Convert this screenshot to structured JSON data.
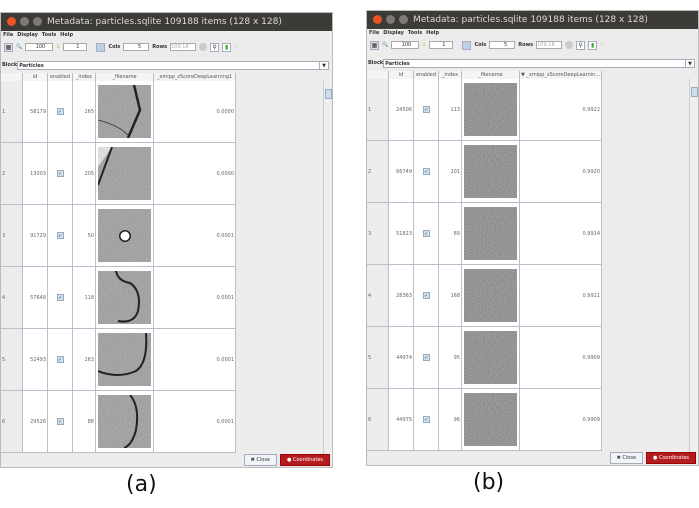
{
  "windows": [
    {
      "title": "Metadata: particles.sqlite 109188 items (128 x 128)",
      "menu": [
        "File",
        "Display",
        "Tools",
        "Help"
      ],
      "toolbar": {
        "zoom": "100",
        "goto": "1",
        "cols_label": "Cols",
        "cols": "5",
        "rows_label": "Rows",
        "rows": "109,18"
      },
      "block_label": "Block",
      "block_value": "Particles",
      "columns": [
        "id",
        "enabled",
        "_index",
        "_filename",
        "_xmipp_zScoreDeepLearning1"
      ],
      "rows": [
        {
          "n": "1",
          "id": "58179",
          "index": "165",
          "score": "0.0000",
          "img": "edge1"
        },
        {
          "n": "2",
          "id": "13003",
          "index": "205",
          "score": "0.0000",
          "img": "edge2"
        },
        {
          "n": "3",
          "id": "91729",
          "index": "50",
          "score": "0.0001",
          "img": "dot"
        },
        {
          "n": "4",
          "id": "57648",
          "index": "118",
          "score": "0.0001",
          "img": "edge3"
        },
        {
          "n": "5",
          "id": "52493",
          "index": "163",
          "score": "0.0001",
          "img": "edge4"
        },
        {
          "n": "6",
          "id": "29526",
          "index": "88",
          "score": "0.0001",
          "img": "edge5"
        }
      ],
      "buttons": {
        "close": "Close",
        "coords": "Coordinates"
      },
      "caption": "(a)"
    },
    {
      "title": "Metadata: particles.sqlite 109188 items (128 x 128)",
      "menu": [
        "File",
        "Display",
        "Tools",
        "Help"
      ],
      "toolbar": {
        "zoom": "100",
        "goto": "1",
        "cols_label": "Cols",
        "cols": "5",
        "rows_label": "Rows",
        "rows": "109,18"
      },
      "block_label": "Block",
      "block_value": "Particles",
      "columns": [
        "id",
        "enabled",
        "_index",
        "_filename",
        "▼ _xmipp_zScoreDeepLearnin..."
      ],
      "rows": [
        {
          "n": "1",
          "id": "24506",
          "index": "113",
          "score": "0.9922",
          "img": "noise"
        },
        {
          "n": "2",
          "id": "66749",
          "index": "201",
          "score": "0.9920",
          "img": "noise"
        },
        {
          "n": "3",
          "id": "51823",
          "index": "89",
          "score": "0.9914",
          "img": "noise"
        },
        {
          "n": "4",
          "id": "28363",
          "index": "168",
          "score": "0.9911",
          "img": "noise"
        },
        {
          "n": "5",
          "id": "44974",
          "index": "95",
          "score": "0.9909",
          "img": "noise"
        },
        {
          "n": "6",
          "id": "44975",
          "index": "96",
          "score": "0.9909",
          "img": "noise"
        }
      ],
      "buttons": {
        "close": "Close",
        "coords": "Coordinates"
      },
      "caption": "(b)"
    }
  ],
  "colors": {
    "titlebar": "#3c3b37",
    "coords_button": "#b51c20"
  }
}
